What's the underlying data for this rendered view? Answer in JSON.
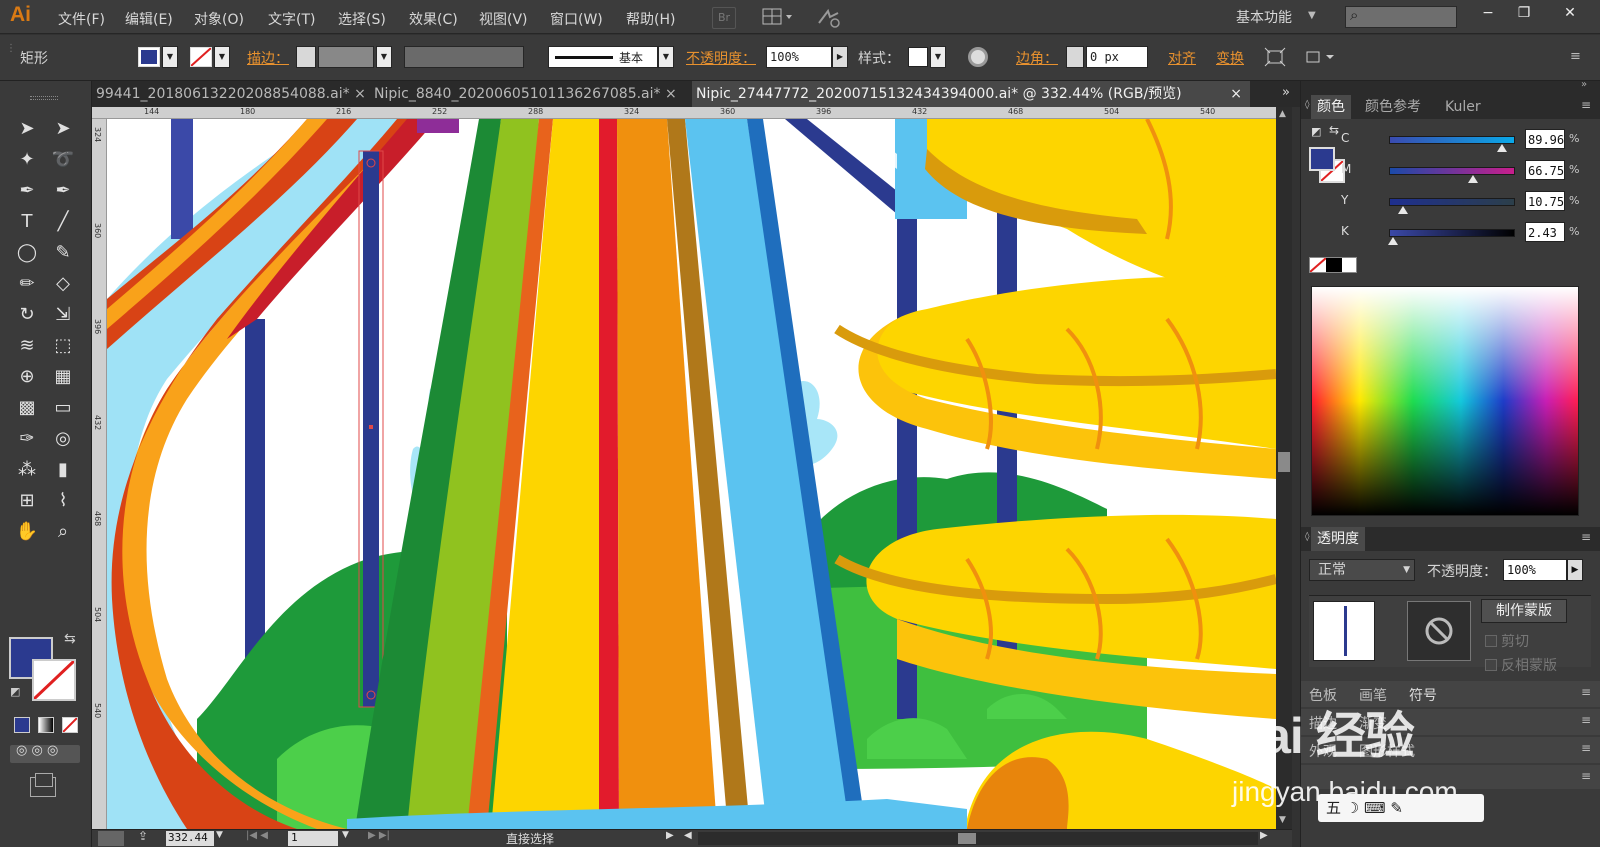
{
  "app": {
    "logo": "Ai"
  },
  "menu": [
    "文件(F)",
    "编辑(E)",
    "对象(O)",
    "文字(T)",
    "选择(S)",
    "效果(C)",
    "视图(V)",
    "窗口(W)",
    "帮助(H)"
  ],
  "menubar_extra": {
    "br": "Br",
    "workspace": "基本功能"
  },
  "window_controls": [
    "−",
    "❐",
    "✕"
  ],
  "control": {
    "tool_name": "矩形",
    "fill_color": "#2b3a8f",
    "stroke_label": "描边：",
    "brush_label": "基本",
    "opacity_label": "不透明度：",
    "opacity_value": "100%",
    "style_label": "样式：",
    "corner_label": "边角：",
    "corner_value": "0 px",
    "align_label": "对齐",
    "transform_label": "变换"
  },
  "tabs": [
    {
      "label": "99441_20180613220208854088.ai*"
    },
    {
      "label": "Nipic_8840_20200605101136267085.ai*"
    },
    {
      "label": "Nipic_27447772_20200715132434394000.ai* @ 332.44% (RGB/预览)",
      "active": true
    }
  ],
  "ruler": {
    "h": [
      "144",
      "180",
      "216",
      "252",
      "288",
      "324",
      "360",
      "396",
      "432",
      "468",
      "504",
      "540"
    ],
    "v": [
      "324",
      "360",
      "396",
      "432",
      "468",
      "504",
      "540"
    ]
  },
  "tools": [
    "selection-icon",
    "direct-selection-icon",
    "magic-wand-icon",
    "lasso-icon",
    "pen-icon",
    "curvature-icon",
    "type-icon",
    "line-icon",
    "ellipse-icon",
    "paintbrush-icon",
    "pencil-icon",
    "eraser-icon",
    "rotate-icon",
    "scale-icon",
    "warp-icon",
    "free-transform-icon",
    "shape-builder-icon",
    "perspective-grid-icon",
    "mesh-icon",
    "gradient-icon",
    "eyedropper-icon",
    "blend-icon",
    "symbol-sprayer-icon",
    "column-graph-icon",
    "artboard-icon",
    "slice-icon",
    "hand-icon",
    "zoom-icon"
  ],
  "color_panel": {
    "tabs": [
      "颜色",
      "颜色参考",
      "Kuler"
    ],
    "channels": [
      {
        "label": "C",
        "value": "89.96",
        "pos": 0.8996
      },
      {
        "label": "M",
        "value": "66.75",
        "pos": 0.6675
      },
      {
        "label": "Y",
        "value": "10.75",
        "pos": 0.1075
      },
      {
        "label": "K",
        "value": "2.43",
        "pos": 0.0243
      }
    ],
    "pct": "%"
  },
  "transparency_panel": {
    "title": "透明度",
    "mode": "正常",
    "opacity_label": "不透明度：",
    "opacity": "100%",
    "make_mask": "制作蒙版",
    "clip": "剪切",
    "invert": "反相蒙版"
  },
  "collapsed_panels": [
    {
      "items": [
        "色板",
        "画笔",
        "符号"
      ]
    },
    {
      "items": [
        "描边",
        "渐变"
      ]
    },
    {
      "items": [
        "外观",
        "图形样式"
      ]
    }
  ],
  "status": {
    "zoom": "332.44",
    "artboard": "1",
    "tool": "直接选择"
  },
  "watermark": {
    "brand": "Bai  经验",
    "url": "jingyan.baidu.com",
    "ime": "五 ☽ ⌨ ✎"
  }
}
